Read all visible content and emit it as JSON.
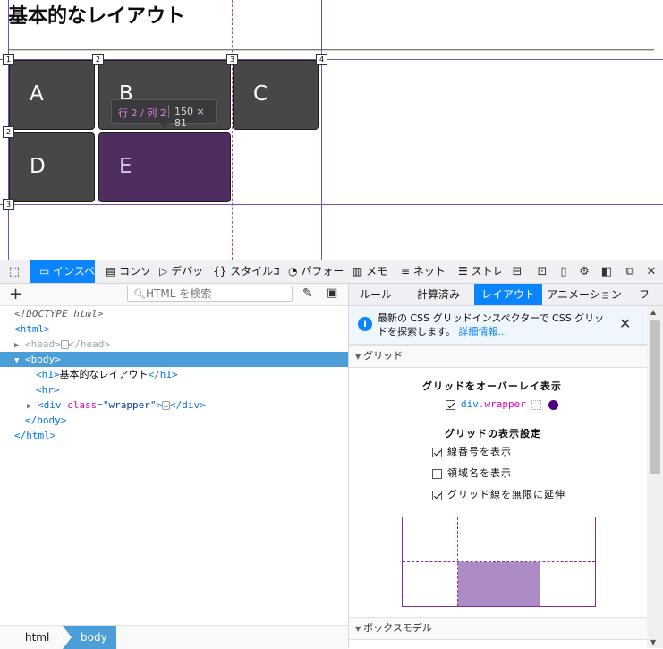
{
  "page": {
    "heading": "基本的なレイアウト",
    "items": [
      "A",
      "B",
      "C",
      "D",
      "E"
    ],
    "grid_column_lines": [
      "1",
      "2",
      "3",
      "4"
    ],
    "grid_row_lines": [
      "1",
      "2",
      "3"
    ],
    "tooltip": {
      "area": "行 2 / 列 2",
      "size": "150 × 81"
    }
  },
  "toolbar": {
    "tabs": [
      {
        "label": "インスペ",
        "icon": "inspector-icon"
      },
      {
        "label": "コンソ",
        "icon": "console-icon"
      },
      {
        "label": "デバッ",
        "icon": "debugger-icon"
      },
      {
        "label": "スタイルエ",
        "icon": "style-editor-icon"
      },
      {
        "label": "パフォーマ",
        "icon": "performance-icon"
      },
      {
        "label": "メモ",
        "icon": "memory-icon"
      },
      {
        "label": "ネット",
        "icon": "network-icon"
      },
      {
        "label": "ストレ",
        "icon": "storage-icon"
      }
    ]
  },
  "inspector": {
    "search_placeholder": "HTML を検索",
    "markup": {
      "doctype": "<!DOCTYPE html>",
      "html_open": "<html>",
      "head": "head",
      "body": "body",
      "h1_text": "基本的なレイアウト",
      "hr": "<hr>",
      "div_tag": "div",
      "div_attr": "class",
      "div_value": "\"wrapper\"",
      "body_close": "</body>",
      "html_close": "</html>"
    },
    "breadcrumbs": [
      "html",
      "body"
    ]
  },
  "sidebar": {
    "tabs": [
      "ルール",
      "計算済み",
      "レイアウト",
      "アニメーション",
      "フ"
    ],
    "active_tab": "レイアウト",
    "notice": {
      "text": "最新の CSS グリッドインスペクターで CSS グリッドを探索します。",
      "link": "詳細情報..."
    },
    "grid_section": "グリッド",
    "overlay_heading": "グリッドをオーバーレイ表示",
    "grid_item": {
      "element": "div",
      "class": ".wrapper",
      "color": "#4b0082"
    },
    "display_heading": "グリッドの表示設定",
    "options": [
      {
        "label": "線番号を表示",
        "checked": true
      },
      {
        "label": "領域名を表示",
        "checked": false
      },
      {
        "label": "グリッド線を無限に延伸",
        "checked": true
      }
    ],
    "box_model_section": "ボックスモデル"
  },
  "colors": {
    "accent": "#0a84ff",
    "grid_line": "#7a4fa8",
    "highlight_cell": "#4d2e5e",
    "cell": "#474747"
  }
}
